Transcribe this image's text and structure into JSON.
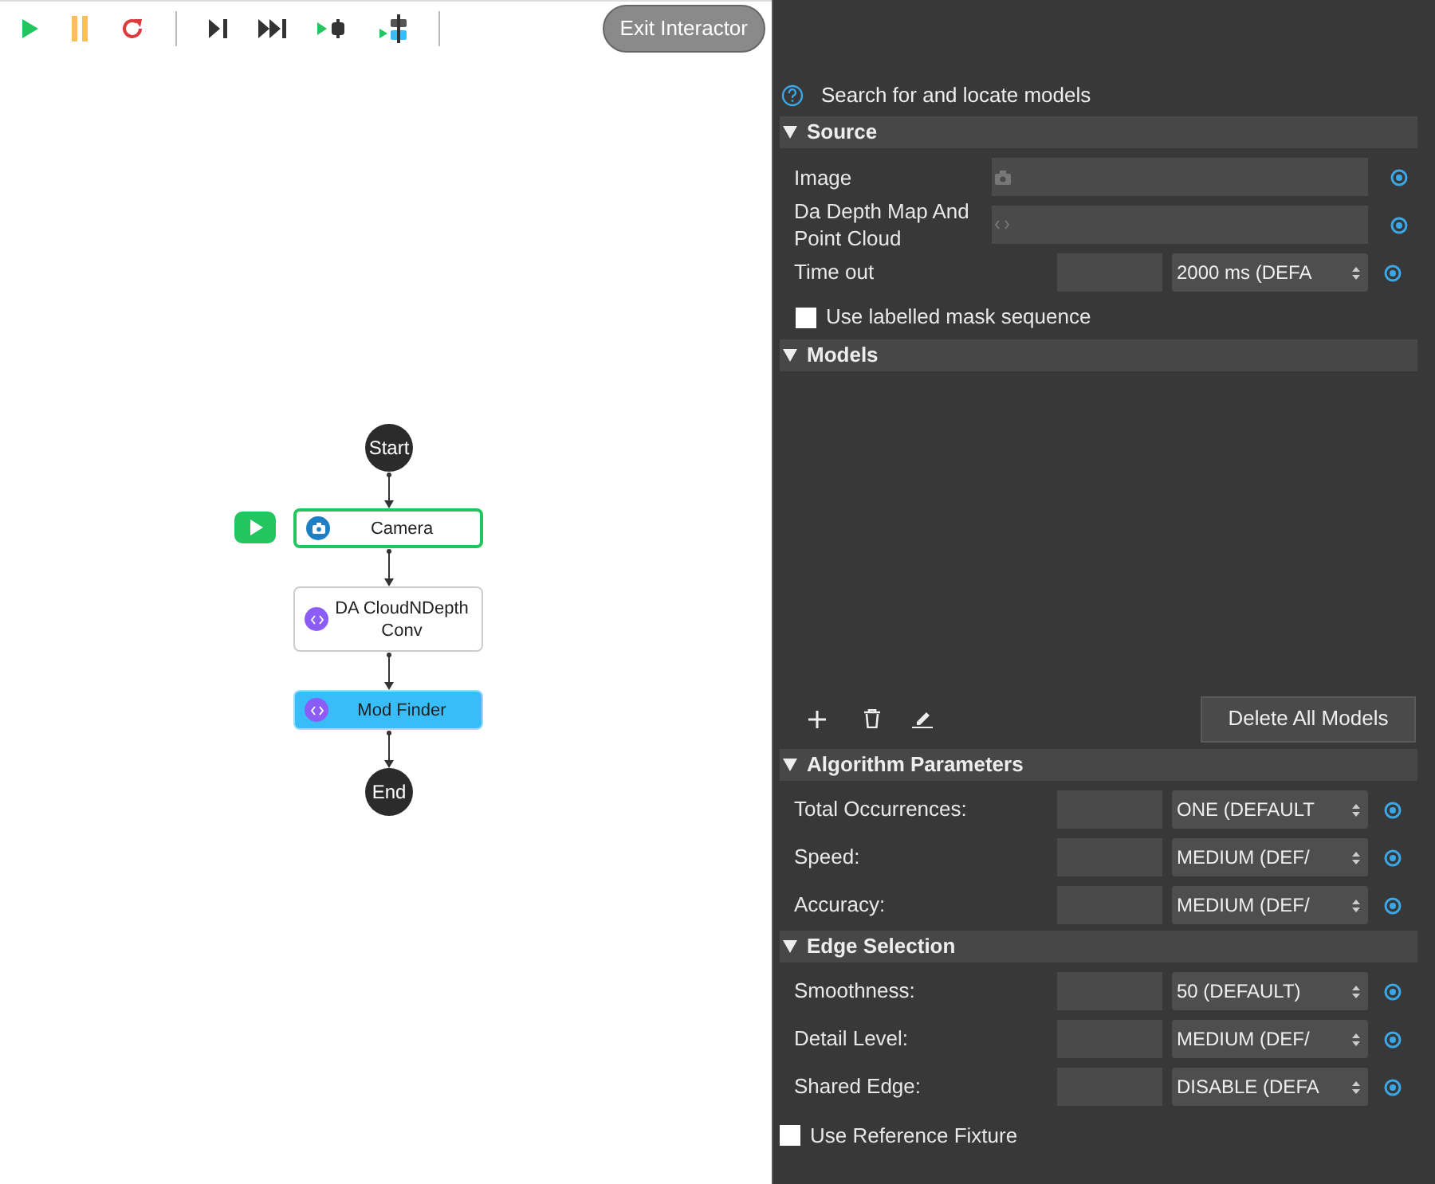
{
  "toolbar": {
    "buttons": [
      {
        "kind": "play"
      },
      {
        "kind": "pause"
      },
      {
        "kind": "restart"
      },
      {
        "kind": "sep"
      },
      {
        "kind": "step"
      },
      {
        "kind": "fastforward"
      },
      {
        "kind": "step-over"
      },
      {
        "kind": "step-into"
      },
      {
        "kind": "sep"
      }
    ],
    "exit_button": "Exit Interactor"
  },
  "flow": {
    "nodes": [
      {
        "kind": "terminal",
        "label": "Start"
      },
      {
        "kind": "step",
        "label": "Camera",
        "running": true,
        "selected": false
      },
      {
        "kind": "step",
        "label": "DA CloudNDepth Conv",
        "running": false,
        "selected": false
      },
      {
        "kind": "step",
        "label": "Mod Finder",
        "running": false,
        "selected": true
      },
      {
        "kind": "terminal",
        "label": "End"
      }
    ]
  },
  "panel": {
    "description": "Search for and locate models",
    "sections": [
      {
        "title": "Source",
        "expanded": true,
        "rows": [
          {
            "kind": "input",
            "label": "Image"
          },
          {
            "kind": "input",
            "label": "Da Depth Map And Point Cloud"
          },
          {
            "kind": "select",
            "label": "Time out",
            "value": "2000 ms (DEFA"
          },
          {
            "kind": "checkbox",
            "label": "Use labelled mask sequence",
            "checked": false
          }
        ]
      },
      {
        "title": "Models",
        "expanded": true,
        "kind": "models",
        "button": "Delete All Models"
      },
      {
        "title": "Algorithm Parameters",
        "expanded": true,
        "rows": [
          {
            "kind": "select",
            "label": "Total Occurrences:",
            "value": "ONE (DEFAULT"
          },
          {
            "kind": "select",
            "label": "Speed:",
            "value": "MEDIUM (DEF/"
          },
          {
            "kind": "select",
            "label": "Accuracy:",
            "value": "MEDIUM (DEF/"
          }
        ]
      },
      {
        "title": "Edge Selection",
        "expanded": true,
        "rows": [
          {
            "kind": "select",
            "label": "Smoothness:",
            "value": "50 (DEFAULT)"
          },
          {
            "kind": "select",
            "label": "Detail Level:",
            "value": "MEDIUM (DEF/"
          },
          {
            "kind": "select",
            "label": "Shared Edge:",
            "value": "DISABLE (DEFA"
          }
        ]
      }
    ],
    "fixture": {
      "label": "Use Reference Fixture",
      "checked": false
    }
  }
}
